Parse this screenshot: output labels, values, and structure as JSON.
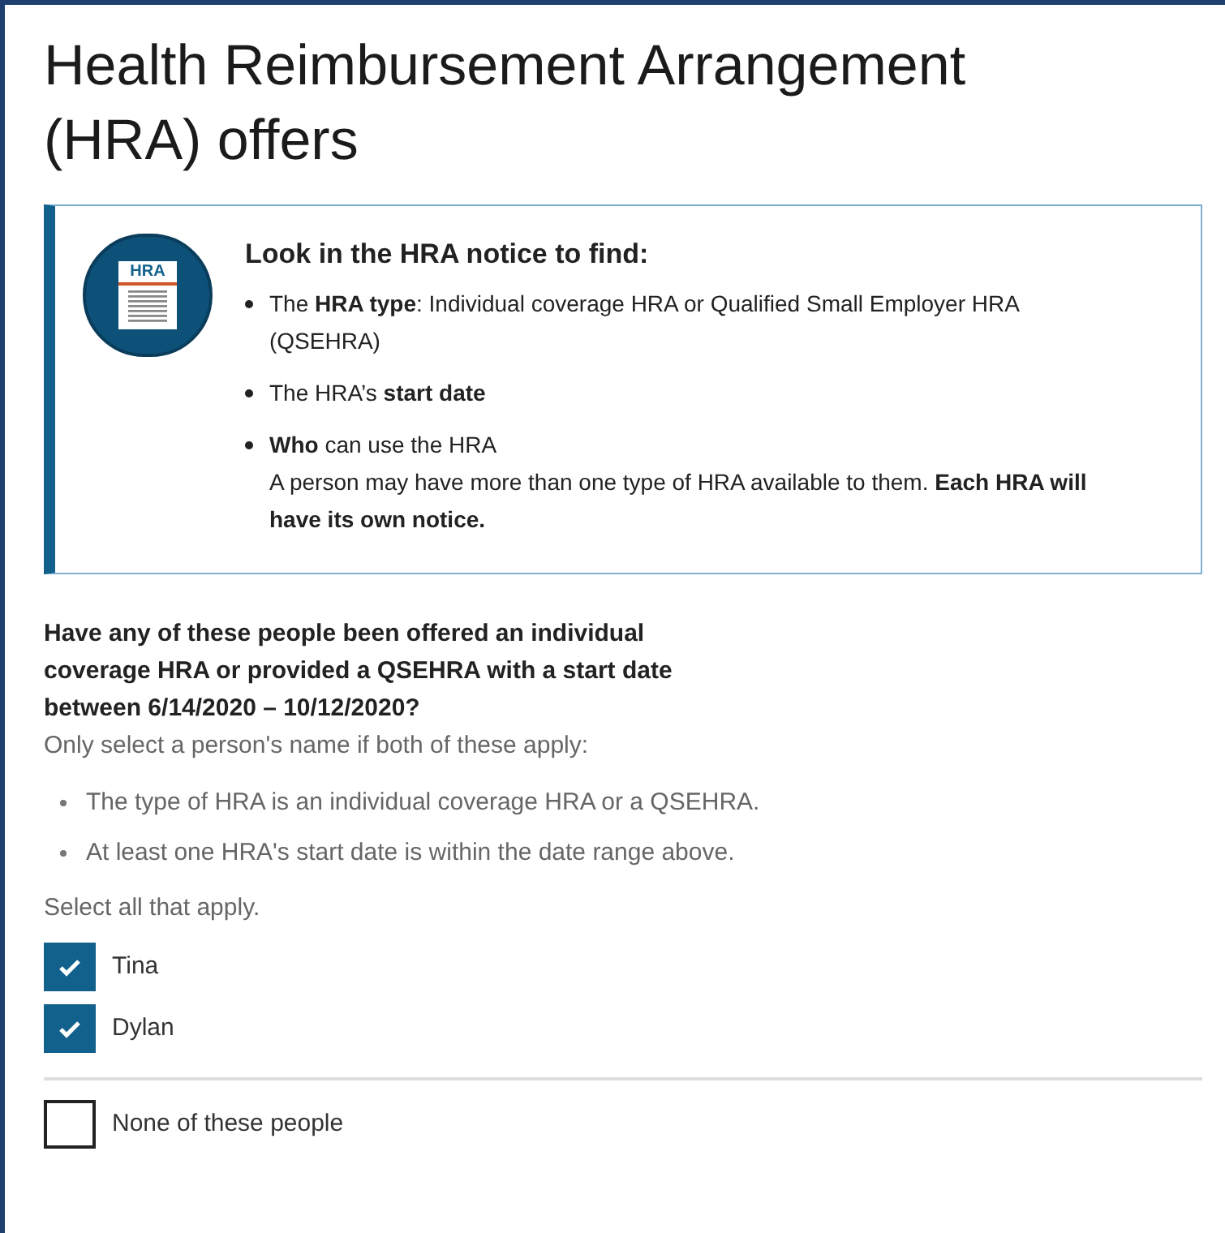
{
  "title": "Health Reimbursement Arrangement (HRA) offers",
  "notice": {
    "icon_label": "HRA",
    "heading": "Look in the HRA notice to find:",
    "items": [
      {
        "text": "The **HRA type**: Individual coverage HRA or Qualified Small Employer HRA (QSEHRA)"
      },
      {
        "text": "The HRA’s **start date**"
      },
      {
        "text": "**Who** can use the HRA",
        "note": "A person may have more than one type of HRA available to them. **Each HRA will have its own notice.**"
      }
    ]
  },
  "question": {
    "text": "Have any of these people been offered an individual coverage HRA or provided a QSEHRA with a start date between 6/14/2020 – 10/12/2020?",
    "hint": "Only select a person's name if both of these apply:",
    "conditions": [
      "The type of HRA is an individual coverage HRA or a QSEHRA.",
      "At least one HRA's start date is within the date range above."
    ],
    "instruction": "Select all that apply.",
    "options": [
      {
        "label": "Tina",
        "checked": true
      },
      {
        "label": "Dylan",
        "checked": true
      }
    ],
    "none_option": {
      "label": "None of these people",
      "checked": false
    }
  }
}
